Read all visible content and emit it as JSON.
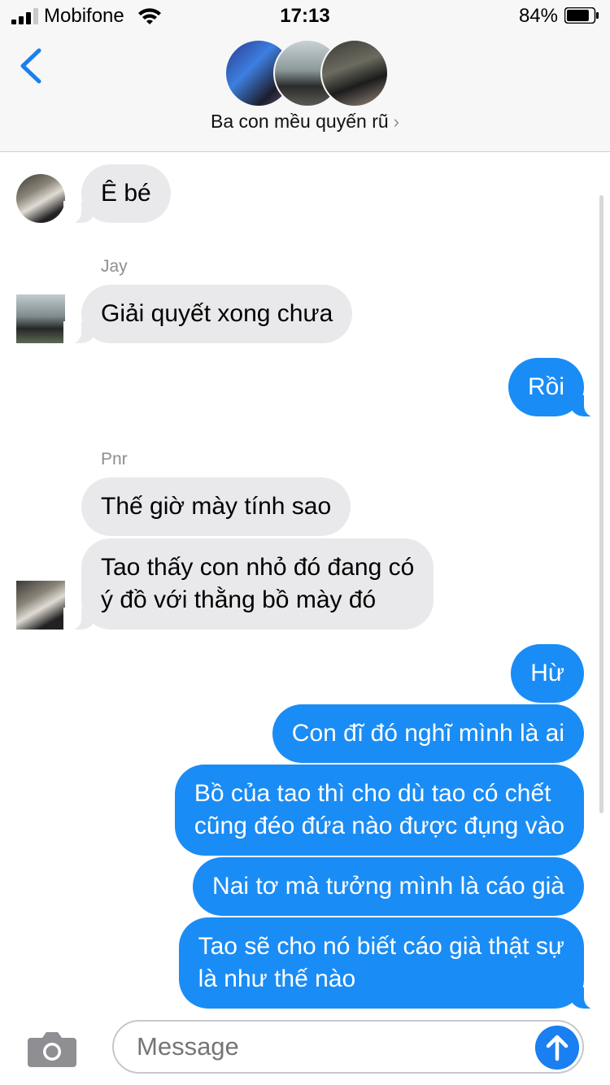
{
  "status_bar": {
    "carrier": "Mobifone",
    "time": "17:13",
    "battery_percent": "84%",
    "battery_level": 0.84,
    "signal_bars_active": 3,
    "icons": [
      "signal-icon",
      "wifi-icon",
      "battery-icon"
    ]
  },
  "header": {
    "back_icon": "chevron-left-icon",
    "group_name": "Ba con mều quyến rũ",
    "title_chevron": "›",
    "avatar_count": 3
  },
  "messages": [
    {
      "direction": "in",
      "sender": "Pnr",
      "text": "Ê bé"
    },
    {
      "direction": "in",
      "sender": "Jay",
      "text": "Giải quyết xong chưa"
    },
    {
      "direction": "out",
      "text": "Rồi"
    },
    {
      "direction": "in",
      "sender": "Pnr",
      "text": "Thế giờ mày tính sao"
    },
    {
      "direction": "in",
      "sender": "Pnr",
      "text_lines": [
        "Tao thấy con nhỏ đó đang có",
        "ý đồ với thằng bồ mày đó"
      ]
    },
    {
      "direction": "out",
      "text": "Hừ"
    },
    {
      "direction": "out",
      "text": "Con đĩ đó nghĩ mình là ai"
    },
    {
      "direction": "out",
      "text_lines": [
        "Bồ của tao thì cho dù tao có chết",
        "cũng đéo đứa nào được đụng vào"
      ]
    },
    {
      "direction": "out",
      "text": "Nai tơ mà tưởng mình là cáo già"
    },
    {
      "direction": "out",
      "text_lines": [
        "Tao sẽ cho nó biết cáo già thật sự",
        "là như thế nào"
      ]
    }
  ],
  "labels": {
    "jay": "Jay",
    "pnr": "Pnr"
  },
  "input_bar": {
    "placeholder": "Message",
    "camera_icon": "camera-icon",
    "send_icon": "arrow-up-icon"
  },
  "colors": {
    "outgoing_bubble": "#1a8cf5",
    "incoming_bubble": "#e9e9eb",
    "accent": "#1a7ff0",
    "header_bg": "#f7f7f7"
  }
}
